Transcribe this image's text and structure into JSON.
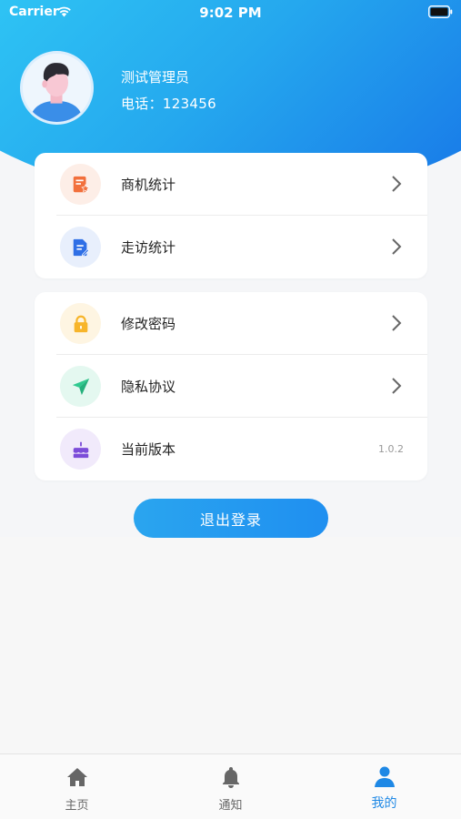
{
  "status_bar": {
    "carrier": "Carrier",
    "time": "9:02 PM"
  },
  "profile": {
    "name": "测试管理员",
    "phone": "电话：123456"
  },
  "menu_group_1": [
    {
      "label": "商机统计",
      "icon": "opportunity-stats-icon",
      "color": "#f2703c"
    },
    {
      "label": "走访统计",
      "icon": "visit-stats-icon",
      "color": "#2f6fe6"
    }
  ],
  "menu_group_2": [
    {
      "label": "修改密码",
      "icon": "lock-icon",
      "color": "#f7b52b"
    },
    {
      "label": "隐私协议",
      "icon": "paper-plane-icon",
      "color": "#2fc98f"
    },
    {
      "label": "当前版本",
      "icon": "cake-icon",
      "color": "#7c4cd9",
      "value": "1.0.2"
    }
  ],
  "logout_label": "退出登录",
  "tabs": [
    {
      "label": "主页",
      "icon": "home-icon"
    },
    {
      "label": "通知",
      "icon": "bell-icon"
    },
    {
      "label": "我的",
      "icon": "user-icon",
      "active": true
    }
  ],
  "colors": {
    "accent": "#1e88e5",
    "header_start": "#2ec3f4",
    "header_end": "#1878e8"
  }
}
